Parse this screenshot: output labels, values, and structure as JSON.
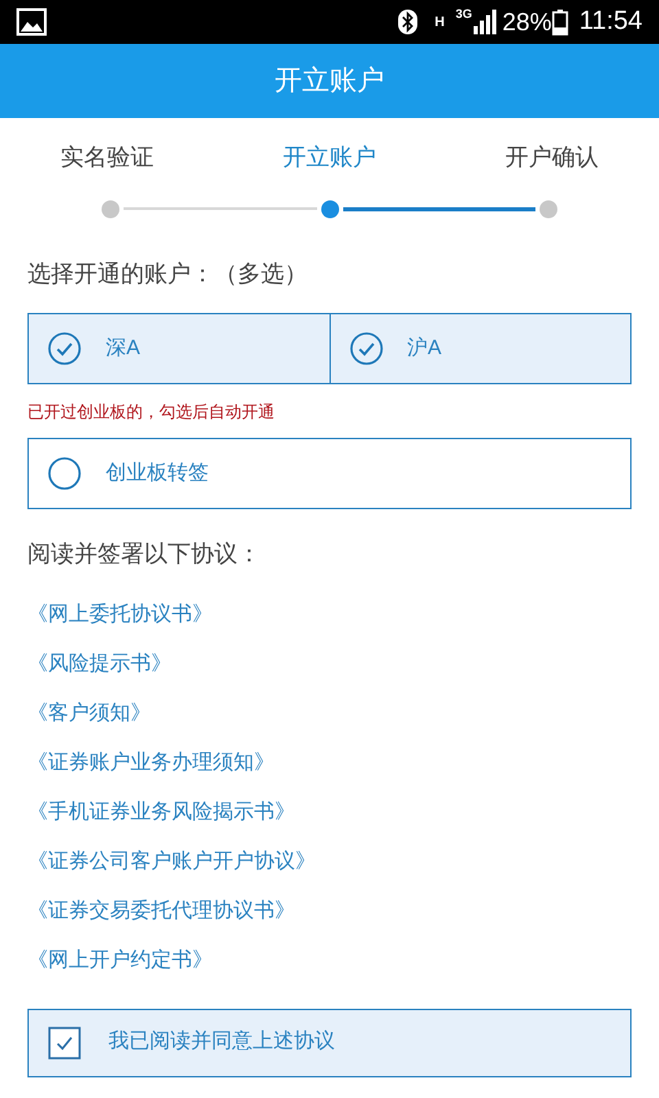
{
  "status_bar": {
    "network_type": "H",
    "network_gen": "3G",
    "battery": "28%",
    "time": "11:54"
  },
  "header": {
    "title": "开立账户"
  },
  "steps": [
    {
      "label": "实名验证",
      "selected": false
    },
    {
      "label": "开立账户",
      "selected": true
    },
    {
      "label": "开户确认",
      "selected": false
    }
  ],
  "accounts": {
    "label": "选择开通的账户：（多选）",
    "options": [
      {
        "label": "深A",
        "checked": true
      },
      {
        "label": "沪A",
        "checked": true
      }
    ]
  },
  "note": "已开过创业板的，勾选后自动开通",
  "chinext": {
    "label": "创业板转签",
    "checked": false
  },
  "agreements": {
    "label": "阅读并签署以下协议：",
    "links": [
      "《网上委托协议书》",
      "《风险提示书》",
      "《客户须知》",
      "《证券账户业务办理须知》",
      "《手机证券业务风险揭示书》",
      "《证券公司客户账户开户协议》",
      "《证券交易委托代理协议书》",
      "《网上开户约定书》"
    ]
  },
  "consent": {
    "label": "我已阅读并同意上述协议",
    "checked": true
  }
}
